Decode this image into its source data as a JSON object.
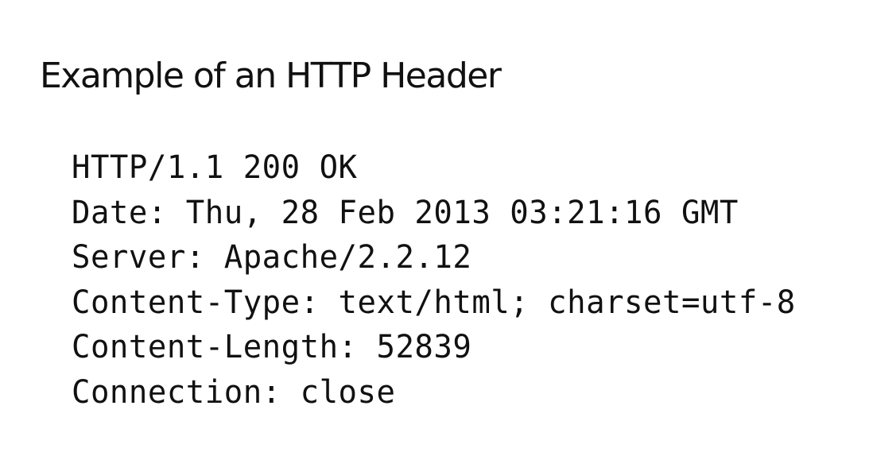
{
  "title": "Example of an HTTP Header",
  "header_lines": [
    "HTTP/1.1 200 OK",
    "Date: Thu, 28 Feb 2013 03:21:16 GMT",
    "Server: Apache/2.2.12",
    "Content-Type: text/html; charset=utf-8",
    "Content-Length: 52839",
    "Connection: close"
  ]
}
